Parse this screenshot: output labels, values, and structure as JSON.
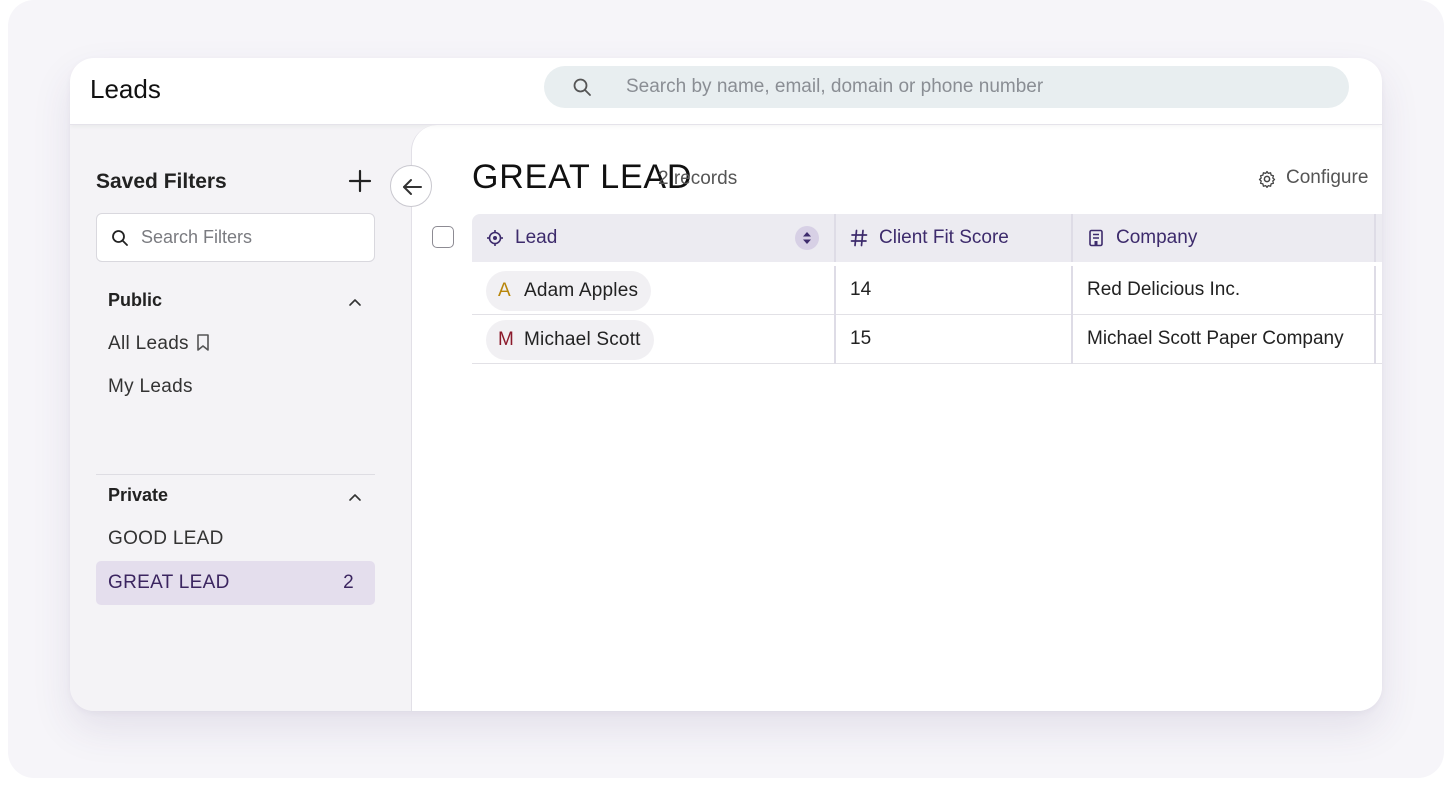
{
  "header": {
    "title": "Leads",
    "search_placeholder": "Search by name, email, domain or phone number"
  },
  "sidebar": {
    "title": "Saved Filters",
    "search_placeholder": "Search Filters",
    "public": {
      "label": "Public",
      "items": [
        {
          "label": "All Leads",
          "icon": "bookmark-icon"
        },
        {
          "label": "My Leads"
        }
      ]
    },
    "private": {
      "label": "Private",
      "items": [
        {
          "label": "GOOD LEAD"
        },
        {
          "label": "GREAT LEAD",
          "count": "2",
          "active": true
        }
      ]
    }
  },
  "main": {
    "title": "GREAT LEAD",
    "record_count": "2 records",
    "configure_label": "Configure",
    "columns": [
      {
        "label": "Lead",
        "icon": "target-icon"
      },
      {
        "label": "Client Fit Score",
        "icon": "hash-icon"
      },
      {
        "label": "Company",
        "icon": "building-icon"
      }
    ],
    "rows": [
      {
        "initial": "A",
        "initial_color": "#b8860b",
        "lead": "Adam Apples",
        "score": "14",
        "company": "Red Delicious Inc."
      },
      {
        "initial": "M",
        "initial_color": "#8b1a2b",
        "lead": "Michael Scott",
        "score": "15",
        "company": "Michael Scott Paper Company"
      }
    ]
  },
  "colors": {
    "accent": "#3d2b6c",
    "active_filter_bg": "#e4deed",
    "search_bg": "#e8eef0"
  }
}
